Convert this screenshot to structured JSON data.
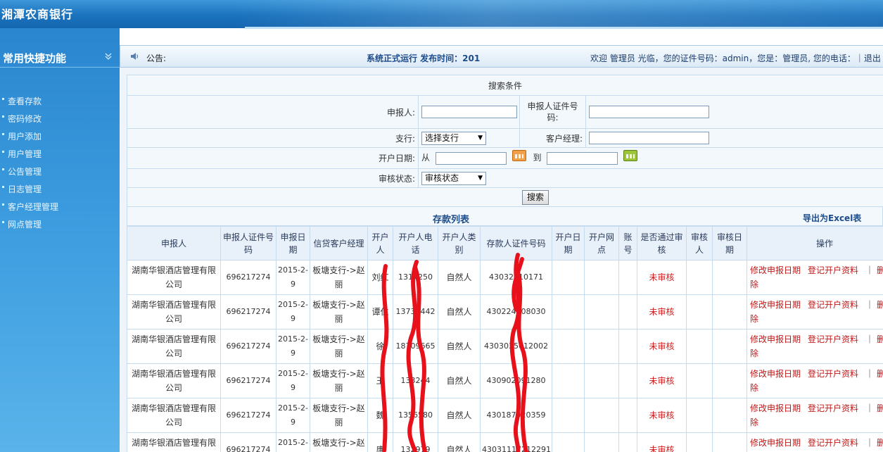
{
  "app": {
    "title": "湘潭农商银行"
  },
  "sidebar": {
    "title": "常用快捷功能",
    "toggle_icon": "chevron-double-down-icon",
    "items": [
      {
        "label": "查看存款"
      },
      {
        "label": "密码修改"
      },
      {
        "label": "用户添加"
      },
      {
        "label": "用户管理"
      },
      {
        "label": "公告管理"
      },
      {
        "label": "日志管理"
      },
      {
        "label": "客户经理管理"
      },
      {
        "label": "网点管理"
      }
    ]
  },
  "notice": {
    "icon": "speaker-icon",
    "label": "公告:",
    "text": "系统正式运行 发布时间：201",
    "welcome": "欢迎 管理员 光临，您的证件号码：admin，您是：管理员, 您的电话：｜退出"
  },
  "search": {
    "title": "搜索条件",
    "applicant_label": "申报人:",
    "applicant_id_label": "申报人证件号码:",
    "branch_label": "支行:",
    "branch_value": "选择支行",
    "manager_label": "客户经理:",
    "date_label": "开户日期:",
    "date_from": "从",
    "date_to": "到",
    "status_label": "审核状态:",
    "status_value": "审核状态",
    "search_button": "搜索"
  },
  "list": {
    "title": "存款列表",
    "export": "导出为Excel表",
    "columns": [
      "申报人",
      "申报人证件号码",
      "申报日期",
      "信贷客户经理",
      "开户人",
      "开户人电话",
      "开户人类别",
      "存款人证件号码",
      "开户日期",
      "开户网点",
      "账号",
      "是否通过审核",
      "审核人",
      "审核日期",
      "操作"
    ],
    "rows": [
      {
        "applicant": "湖南华银酒店管理有限公司",
        "applicant_id": "696217274",
        "date": "2015-2-9",
        "manager": "板塘支行->赵丽",
        "holder": "刘红",
        "phone": "1317250",
        "type": "自然人",
        "depositor_id": "43032010171",
        "status": "未审核"
      },
      {
        "applicant": "湖南华银酒店管理有限公司",
        "applicant_id": "696217274",
        "date": "2015-2-9",
        "manager": "板塘支行->赵丽",
        "holder": "谭仁",
        "phone": "13731442",
        "type": "自然人",
        "depositor_id": "430224908030",
        "status": "未审核"
      },
      {
        "applicant": "湖南华银酒店管理有限公司",
        "applicant_id": "696217274",
        "date": "2015-2-9",
        "manager": "板塘支行->赵丽",
        "holder": "徐",
        "phone": "18709665",
        "type": "自然人",
        "depositor_id": "4303035012002",
        "status": "未审核"
      },
      {
        "applicant": "湖南华银酒店管理有限公司",
        "applicant_id": "696217274",
        "date": "2015-2-9",
        "manager": "板塘支行->赵丽",
        "holder": "王",
        "phone": "133244",
        "type": "自然人",
        "depositor_id": "430902091280",
        "status": "未审核"
      },
      {
        "applicant": "湖南华银酒店管理有限公司",
        "applicant_id": "696217274",
        "date": "2015-2-9",
        "manager": "板塘支行->赵丽",
        "holder": "魏",
        "phone": "1356580",
        "type": "自然人",
        "depositor_id": "430187020359",
        "status": "未审核"
      },
      {
        "applicant": "湖南华银酒店管理有限公司",
        "applicant_id": "696217274",
        "date": "2015-2-9",
        "manager": "板塘支行->赵丽",
        "holder": "唐",
        "phone": "132979",
        "type": "自然人",
        "depositor_id": "43031117212291",
        "status": "未审核"
      }
    ],
    "ops": {
      "modify": "修改申报日期",
      "register": "登记开户资料",
      "sep": "｜",
      "delete": "删除"
    }
  },
  "colors": {
    "header_blue": "#1a72bd",
    "sidebar_blue": "#3e9ee0",
    "grid": "#c6dbee",
    "op_red": "#c01818",
    "scribble_red": "#e8101a"
  }
}
